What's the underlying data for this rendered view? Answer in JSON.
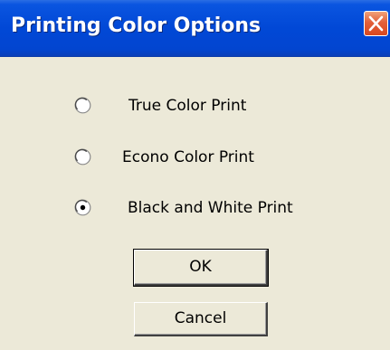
{
  "dialog": {
    "title": "Printing Color Options",
    "close_icon": "close-icon",
    "accent_color": "#0148d6",
    "close_color": "#e2603a"
  },
  "options": [
    {
      "label": "True Color Print",
      "selected": false
    },
    {
      "label": "Econo Color Print",
      "selected": false
    },
    {
      "label": "Black and White Print",
      "selected": true
    }
  ],
  "buttons": {
    "ok_label": "OK",
    "cancel_label": "Cancel"
  }
}
